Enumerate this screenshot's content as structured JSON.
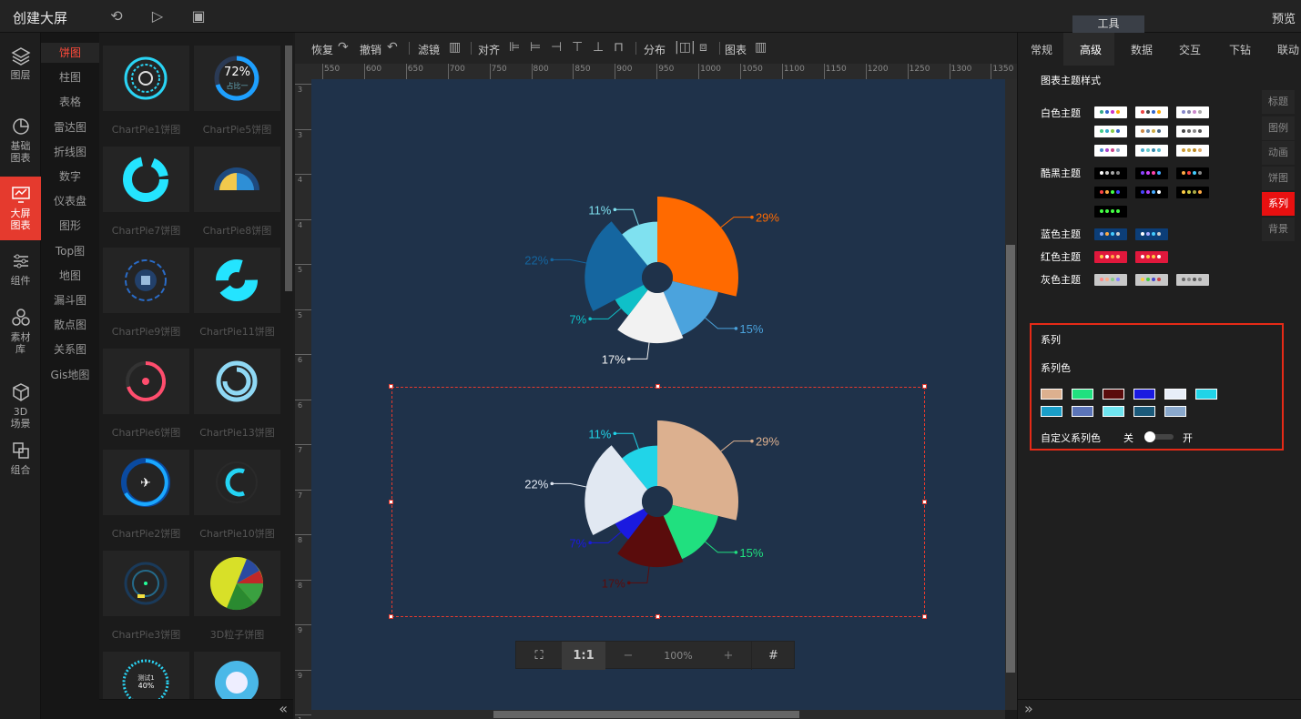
{
  "app": {
    "title": "创建大屏",
    "preview": "预览",
    "tool_tab": "工具"
  },
  "nav": [
    {
      "label1": "图层",
      "label2": "",
      "icon": "layers-icon"
    },
    {
      "label1": "基础",
      "label2": "图表",
      "icon": "pie-chart-icon"
    },
    {
      "label1": "大屏",
      "label2": "图表",
      "icon": "big-screen-icon"
    },
    {
      "label1": "组件",
      "label2": "",
      "icon": "sliders-icon"
    },
    {
      "label1": "素材",
      "label2": "库",
      "icon": "hexagons-icon"
    },
    {
      "label1": "3D",
      "label2": "场景",
      "icon": "cube-icon"
    },
    {
      "label1": "组合",
      "label2": "",
      "icon": "group-icon"
    }
  ],
  "categories": [
    "饼图",
    "柱图",
    "表格",
    "雷达图",
    "折线图",
    "数字",
    "仪表盘",
    "图形",
    "Top图",
    "地图",
    "漏斗图",
    "散点图",
    "关系图",
    "Gis地图"
  ],
  "thumbs": [
    "ChartPie1饼图",
    "ChartPie5饼图",
    "ChartPie7饼图",
    "ChartPie8饼图",
    "ChartPie9饼图",
    "ChartPie11饼图",
    "ChartPie6饼图",
    "ChartPie13饼图",
    "ChartPie2饼图",
    "ChartPie10饼图",
    "ChartPie3饼图",
    "3D粒子饼图"
  ],
  "thumb_texts": {
    "pie5_pct": "72%",
    "pie5_sub": "占比一",
    "bottom1_title": "测试1",
    "bottom1_pct": "40%"
  },
  "toolbar": {
    "redo": "恢复",
    "undo": "撤销",
    "filter": "滤镜",
    "align": "对齐",
    "distribute": "分布",
    "chart": "图表"
  },
  "ruler_top": [
    "550",
    "600",
    "650",
    "700",
    "750",
    "800",
    "850",
    "900",
    "950",
    "1000",
    "1050",
    "1100",
    "1150",
    "1200",
    "1250",
    "1300",
    "1350"
  ],
  "ruler_left": [
    "3",
    "3",
    "4",
    "4",
    "5",
    "5",
    "6",
    "6",
    "7",
    "7",
    "8",
    "8",
    "9",
    "9",
    "1"
  ],
  "zoom": {
    "fit": "⛶",
    "one": "1:1",
    "minus": "−",
    "level": "100%",
    "plus": "+",
    "grid": "#"
  },
  "right_tabs": [
    "常规",
    "高级",
    "数据",
    "交互",
    "下钻",
    "联动"
  ],
  "theme": {
    "section": "图表主题样式",
    "white": "白色主题",
    "dark": "酷黑主题",
    "blue": "蓝色主题",
    "red": "红色主题",
    "gray": "灰色主题"
  },
  "side_tabs": [
    "标题",
    "图例",
    "动画",
    "饼图",
    "系列",
    "背景"
  ],
  "series": {
    "title": "系列",
    "color_label": "系列色",
    "custom_label": "自定义系列色",
    "off": "关",
    "on": "开",
    "colors": [
      "#dcb08f",
      "#20e07f",
      "#5a0c0c",
      "#1a1ae0",
      "#e8eef8",
      "#21d4e8",
      "#1a9ec8",
      "#5b74b8",
      "#6fe4ef",
      "#1b5a7a",
      "#8aa8cc"
    ]
  },
  "chart_data": [
    {
      "type": "pie",
      "title": "",
      "categories": [
        "29%",
        "15%",
        "17%",
        "7%",
        "22%",
        "11%"
      ],
      "values": [
        29,
        15,
        17,
        7,
        22,
        11
      ],
      "colors": [
        "#ff6a00",
        "#4ba3dd",
        "#f2f2f2",
        "#0fc0c8",
        "#1566a0",
        "#7fe1f0"
      ]
    },
    {
      "type": "pie",
      "title": "",
      "categories": [
        "29%",
        "15%",
        "17%",
        "7%",
        "22%",
        "11%"
      ],
      "values": [
        29,
        15,
        17,
        7,
        22,
        11
      ],
      "colors": [
        "#dcb08f",
        "#20e07f",
        "#5a0c0c",
        "#1a1ae0",
        "#e1e8f2",
        "#21d4e8"
      ]
    }
  ]
}
